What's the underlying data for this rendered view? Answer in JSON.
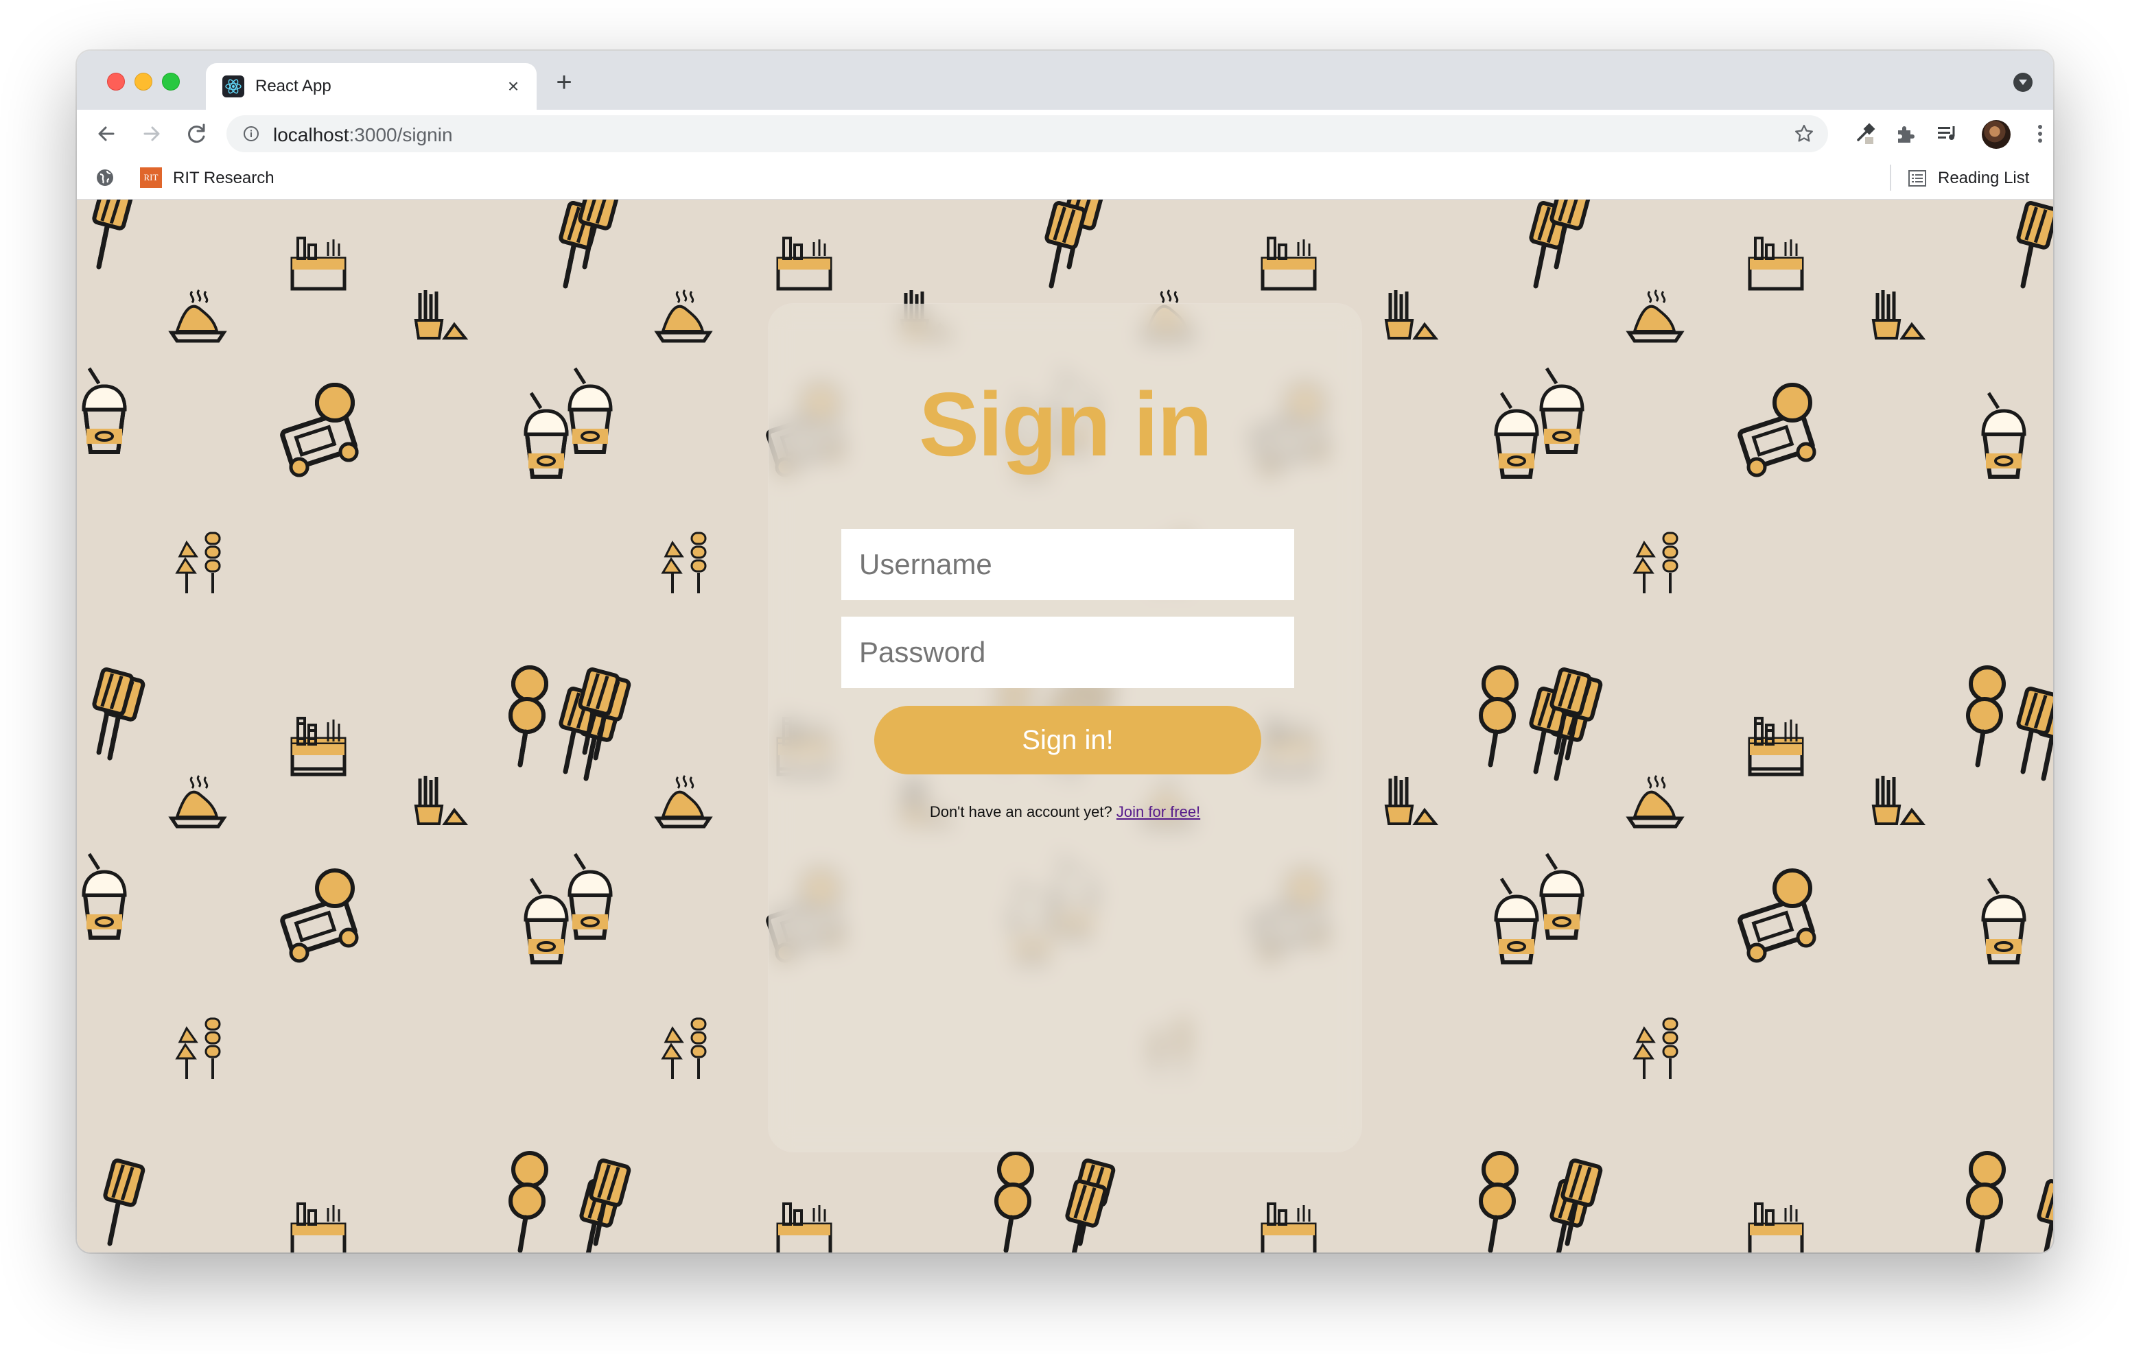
{
  "browser": {
    "tab": {
      "title": "React App",
      "close_glyph": "×",
      "favicon": "react-icon"
    },
    "new_tab_glyph": "+",
    "address": {
      "host": "localhost",
      "path": ":3000/signin"
    },
    "bookmarks": [
      {
        "label": "RIT Research",
        "favicon_text": "RIT"
      }
    ],
    "reading_list_label": "Reading List"
  },
  "signin": {
    "title": "Sign in",
    "username_placeholder": "Username",
    "password_placeholder": "Password",
    "submit_label": "Sign in!",
    "signup_prompt": "Don't have an account yet?",
    "signup_link": "Join for free!"
  },
  "colors": {
    "accent": "#e6b453",
    "background": "#e3dace",
    "link": "#551a8b"
  },
  "background_pattern_icons": [
    "skewer-icon",
    "grill-icon",
    "noodle-bowl-icon",
    "fries-icon",
    "food-truck-icon",
    "bubble-tea-icon",
    "kebab-icon",
    "food-stall-icon"
  ]
}
